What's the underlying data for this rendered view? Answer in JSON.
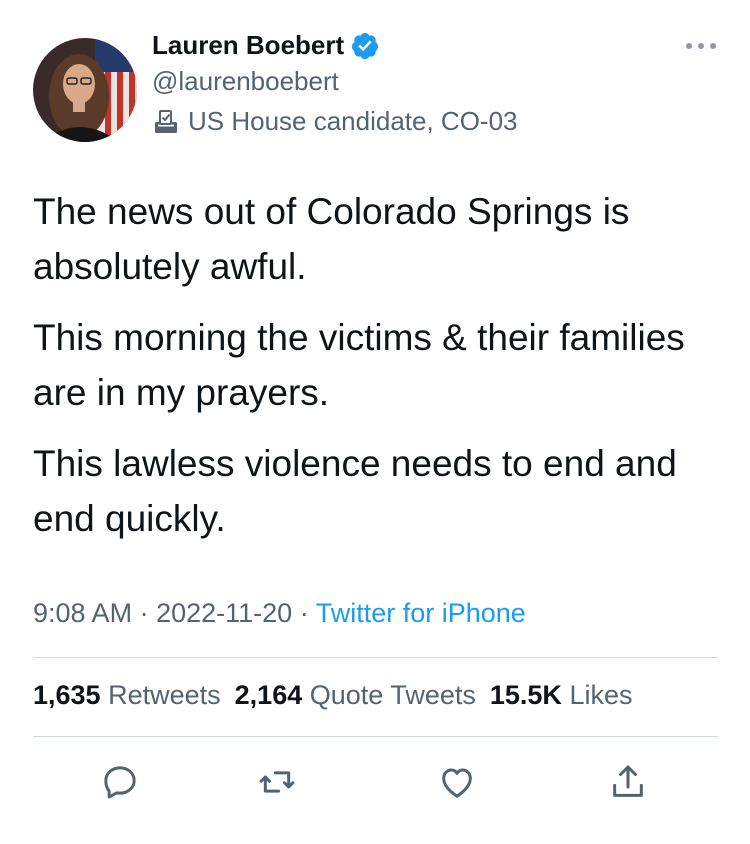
{
  "author": {
    "name": "Lauren Boebert",
    "handle": "@laurenboebert",
    "label": "US House candidate, CO-03"
  },
  "tweet": {
    "paragraphs": [
      "The news out of Colorado Springs is absolutely awful.",
      "This morning the victims & their families are in my prayers.",
      "This lawless violence needs to end and end quickly."
    ],
    "time": "9:08 AM",
    "date": "2022-11-20",
    "source": "Twitter for iPhone"
  },
  "stats": {
    "retweets_count": "1,635",
    "retweets_label": "Retweets",
    "quotes_count": "2,164",
    "quotes_label": "Quote Tweets",
    "likes_count": "15.5K",
    "likes_label": "Likes"
  },
  "icons": {
    "verified": "verified-badge-icon",
    "label": "ballot-box-icon",
    "more": "more-options-icon",
    "reply": "reply-icon",
    "retweet": "retweet-icon",
    "like": "heart-icon",
    "share": "share-icon"
  },
  "colors": {
    "accent": "#1d9bf0",
    "secondary_text": "#536471",
    "primary_text": "#0f1419"
  }
}
